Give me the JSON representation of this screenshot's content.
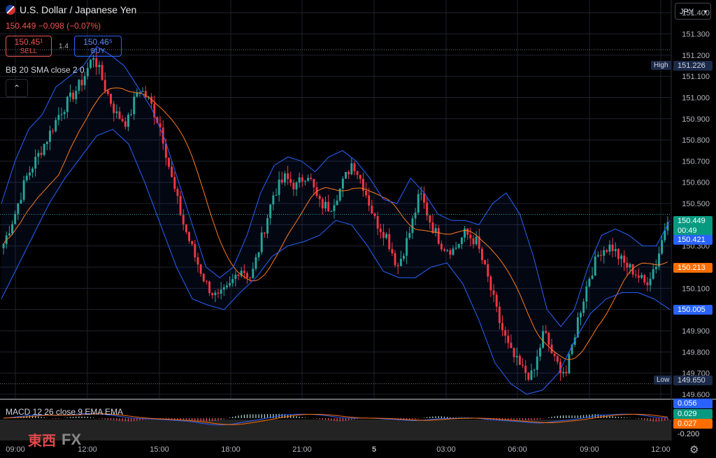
{
  "symbol": {
    "title": "U.S. Dollar / Japanese Yen",
    "change": "150.449  −0.098 (−0.07%)"
  },
  "trade": {
    "sell_price": "150.45¹",
    "sell_label": "SELL",
    "spread": "1.4",
    "buy_price": "150.46⁵",
    "buy_label": "BUY"
  },
  "indicator_label": "BB 20 SMA close 2 0",
  "collapse_icon": "chevron-up-icon",
  "currency_button": "JPY",
  "macd_label": "MACD 12 26 close 9 EMA EMA",
  "logo": {
    "text": "東西",
    "fx": "FX"
  },
  "price_axis": [
    "151.400",
    "151.300",
    "151.200",
    "151.100",
    "151.000",
    "150.900",
    "150.800",
    "150.700",
    "150.600",
    "150.500",
    "150.400",
    "150.300",
    "150.200",
    "150.100",
    "150.000",
    "149.900",
    "149.800",
    "149.700",
    "149.600"
  ],
  "time_axis": [
    "09:00",
    "12:00",
    "15:00",
    "18:00",
    "21:00",
    "5",
    "03:00",
    "06:00",
    "09:00",
    "12:00"
  ],
  "tags": {
    "high_label": "High",
    "high_value": "151.226",
    "low_label": "Low",
    "low_value": "149.650",
    "last": "150.449",
    "countdown": "00:49",
    "bb_upper": "150.421",
    "bb_basis": "150.213",
    "bb_lower": "150.005",
    "macd_line": "0.056",
    "macd_hist": "0.029",
    "macd_signal": "0.027",
    "macd_axis": "-0.200"
  },
  "colors": {
    "up": "#26a69a",
    "down": "#f23645",
    "band": "#2962ff",
    "basis": "#ff7b1f",
    "macd": "#2962ff",
    "signal": "#ff6d00"
  },
  "chart_data": {
    "type": "candlestick",
    "symbol": "USDJPY",
    "ylim": [
      149.58,
      151.46
    ],
    "x_ticks": [
      "09:00",
      "12:00",
      "15:00",
      "18:00",
      "21:00",
      "5",
      "03:00",
      "06:00",
      "09:00",
      "12:00"
    ],
    "close_path": [
      150.31,
      150.45,
      150.62,
      150.72,
      150.82,
      150.93,
      151.0,
      151.08,
      151.2,
      151.05,
      150.92,
      150.88,
      151.05,
      150.98,
      150.85,
      150.6,
      150.4,
      150.25,
      150.12,
      150.05,
      150.1,
      150.2,
      150.15,
      150.35,
      150.55,
      150.62,
      150.58,
      150.65,
      150.5,
      150.48,
      150.58,
      150.7,
      150.58,
      150.42,
      150.35,
      150.2,
      150.35,
      150.55,
      150.4,
      150.3,
      150.28,
      150.36,
      150.32,
      150.15,
      149.95,
      149.8,
      149.72,
      149.68,
      149.9,
      149.75,
      149.7,
      149.95,
      150.15,
      150.28,
      150.3,
      150.22,
      150.18,
      150.12,
      150.22,
      150.44
    ],
    "bb_upper_path": [
      150.5,
      150.7,
      150.85,
      150.92,
      151.05,
      151.1,
      151.15,
      151.24,
      151.2,
      151.15,
      151.05,
      150.95,
      150.8,
      150.6,
      150.4,
      150.2,
      150.15,
      150.2,
      150.35,
      150.55,
      150.68,
      150.72,
      150.7,
      150.65,
      150.72,
      150.75,
      150.7,
      150.62,
      150.52,
      150.5,
      150.62,
      150.55,
      150.45,
      150.42,
      150.42,
      150.4,
      150.5,
      150.55,
      150.45,
      150.25,
      150.0,
      149.92,
      150.0,
      150.2,
      150.35,
      150.38,
      150.35,
      150.3,
      150.3,
      150.42
    ],
    "bb_lower_path": [
      150.05,
      150.2,
      150.35,
      150.5,
      150.62,
      150.72,
      150.82,
      150.85,
      150.78,
      150.6,
      150.4,
      150.2,
      150.05,
      150.02,
      150.0,
      150.08,
      150.15,
      150.25,
      150.3,
      150.32,
      150.35,
      150.42,
      150.4,
      150.3,
      150.18,
      150.15,
      150.15,
      150.2,
      150.22,
      150.12,
      149.95,
      149.75,
      149.65,
      149.6,
      149.62,
      149.7,
      149.85,
      149.98,
      150.05,
      150.08,
      150.08,
      150.05,
      150.0
    ]
  }
}
